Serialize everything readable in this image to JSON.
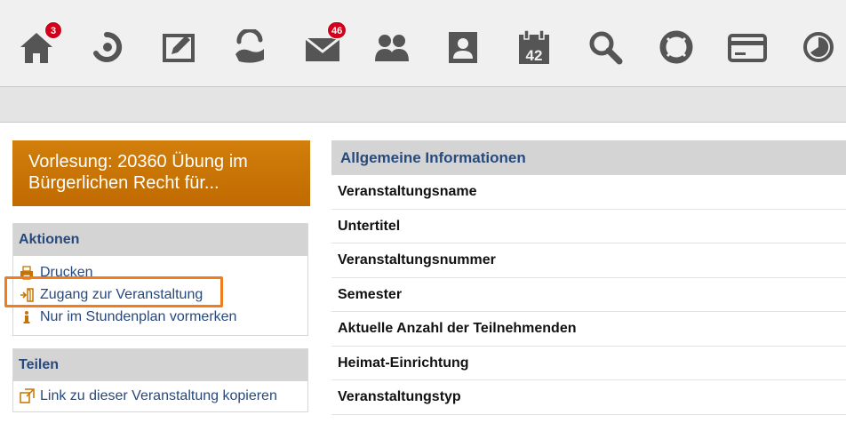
{
  "topnav": {
    "items": [
      {
        "icon": "home-icon",
        "badge": "3"
      },
      {
        "icon": "courses-icon",
        "badge": null
      },
      {
        "icon": "workspace-edit-icon",
        "badge": null
      },
      {
        "icon": "community-icon",
        "badge": null
      },
      {
        "icon": "mail-icon",
        "badge": "46"
      },
      {
        "icon": "contacts-icon",
        "badge": null
      },
      {
        "icon": "profile-icon",
        "badge": null
      },
      {
        "icon": "calendar-icon",
        "badge": null,
        "day": "42"
      },
      {
        "icon": "search-icon",
        "badge": null
      },
      {
        "icon": "help-lifebuoy-icon",
        "badge": null
      },
      {
        "icon": "card-icon",
        "badge": null
      },
      {
        "icon": "activity-pie-icon",
        "badge": null
      }
    ]
  },
  "sidebar": {
    "course_title": "Vorlesung: 20360 Übung im Bürgerlichen Recht für...",
    "actions": {
      "heading": "Aktionen",
      "items": [
        {
          "label": "Drucken",
          "icon": "print-icon"
        },
        {
          "label": "Zugang zur Veranstaltung",
          "icon": "enter-door-icon"
        },
        {
          "label": "Nur im Stundenplan vormerken",
          "icon": "info-icon"
        }
      ]
    },
    "share": {
      "heading": "Teilen",
      "items": [
        {
          "label": "Link zu dieser Veranstaltung kopieren",
          "icon": "copy-link-icon"
        }
      ]
    }
  },
  "main": {
    "heading": "Allgemeine Informationen",
    "rows": [
      "Veranstaltungsname",
      "Untertitel",
      "Veranstaltungsnummer",
      "Semester",
      "Aktuelle Anzahl der Teilnehmenden",
      "Heimat-Einrichtung",
      "Veranstaltungstyp"
    ]
  },
  "colors": {
    "nav_icon": "#555555",
    "accent_orange": "#c87300",
    "link_blue": "#28497c",
    "highlight": "#f07c1c",
    "badge_red": "#d0021b"
  }
}
